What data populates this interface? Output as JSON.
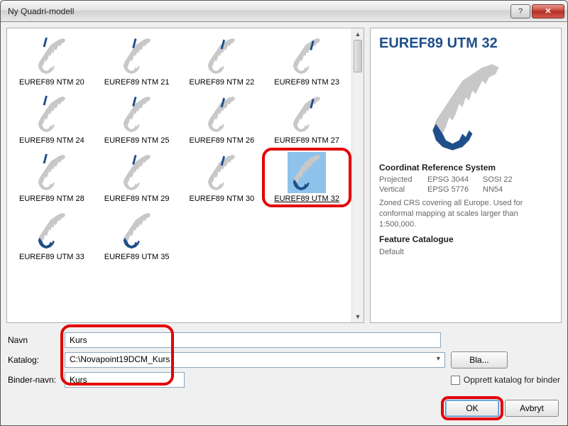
{
  "window": {
    "title": "Ny Quadri-modell"
  },
  "grid": {
    "items": [
      {
        "label": "EUREF89 NTM 20"
      },
      {
        "label": "EUREF89 NTM 21"
      },
      {
        "label": "EUREF89 NTM 22"
      },
      {
        "label": "EUREF89 NTM 23"
      },
      {
        "label": "EUREF89 NTM 24"
      },
      {
        "label": "EUREF89 NTM 25"
      },
      {
        "label": "EUREF89 NTM 26"
      },
      {
        "label": "EUREF89 NTM 27"
      },
      {
        "label": "EUREF89 NTM 28"
      },
      {
        "label": "EUREF89 NTM 29"
      },
      {
        "label": "EUREF89 NTM 30"
      },
      {
        "label": "EUREF89 UTM 32",
        "selected": true
      },
      {
        "label": "EUREF89 UTM 33"
      },
      {
        "label": "EUREF89 UTM 35"
      }
    ]
  },
  "detail": {
    "title": "EUREF89 UTM 32",
    "crs_heading": "Coordinat Reference System",
    "rows": {
      "projected_label": "Projected",
      "projected_epsg": "EPSG 3044",
      "projected_sosi": "SOSI 22",
      "vertical_label": "Vertical",
      "vertical_epsg": "EPSG 5776",
      "vertical_nn": "NN54"
    },
    "description": "Zoned CRS covering all Europe. Used for conformal mapping at scales larger than 1:500,000.",
    "fc_heading": "Feature Catalogue",
    "fc_value": "Default"
  },
  "form": {
    "navn_label": "Navn",
    "navn_value": "Kurs",
    "katalog_label": "Katalog:",
    "katalog_value": "C:\\Novapoint19DCM_Kurs",
    "bla_label": "Bla...",
    "binder_label": "Binder-navn:",
    "binder_value": "Kurs",
    "checkbox_label": "Opprett katalog for binder"
  },
  "buttons": {
    "ok": "OK",
    "cancel": "Avbryt"
  },
  "titlebar_buttons": {
    "help": "?",
    "close": "✕"
  }
}
